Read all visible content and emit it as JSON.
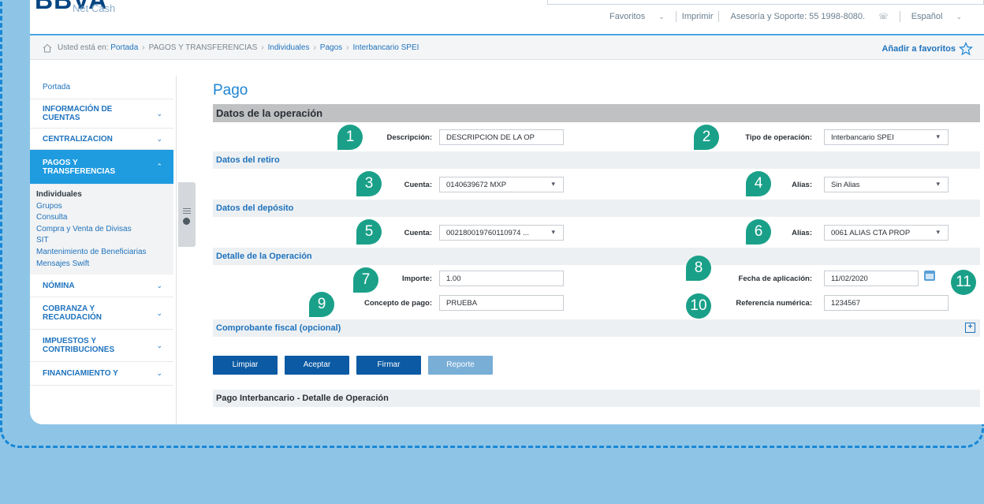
{
  "brand": {
    "logo": "BBVA",
    "sub": "Net Cash"
  },
  "topnav": {
    "favoritos": "Favoritos",
    "imprimir": "Imprimir",
    "soporte": "Asesoría y Soporte: 55 1998-8080.",
    "idioma": "Español"
  },
  "breadcrumb": {
    "prefix": "Usted está en:",
    "items": [
      "Portada",
      "PAGOS Y TRANSFERENCIAS",
      "Individuales",
      "Pagos",
      "Interbancario SPEI"
    ],
    "favorites_label": "Añadir a favoritos"
  },
  "sidebar": {
    "portada": "Portada",
    "info_cuentas": "INFORMACIÓN DE CUENTAS",
    "centralizacion": "CENTRALIZACION",
    "pagos": "PAGOS Y TRANSFERENCIAS",
    "sub_items": [
      "Individuales",
      "Grupos",
      "Consulta",
      "Compra y Venta de Divisas",
      "SIT",
      "Mantenimiento de Beneficiarias",
      "Mensajes Swift"
    ],
    "nomina": "NÓMINA",
    "cobranza": "COBRANZA Y RECAUDACIÓN",
    "impuestos": "IMPUESTOS Y CONTRIBUCIONES",
    "financiamiento": "FINANCIAMIENTO Y"
  },
  "page": {
    "title": "Pago",
    "sec_operacion": "Datos de la operación",
    "descripcion_label": "Descripción:",
    "descripcion_value": "DESCRIPCION DE LA OP",
    "tipo_label": "Tipo de operación:",
    "tipo_value": "Interbancario SPEI",
    "sec_retiro": "Datos del retiro",
    "cuenta_retiro_label": "Cuenta:",
    "cuenta_retiro_value": "0140639672 MXP",
    "alias_retiro_label": "Alias:",
    "alias_retiro_value": "Sin Alias",
    "sec_deposito": "Datos del depósito",
    "cuenta_dep_label": "Cuenta:",
    "cuenta_dep_value": "002180019760110974 ...",
    "alias_dep_label": "Alias:",
    "alias_dep_value": "0061 ALIAS CTA PROP",
    "sec_detalle": "Detalle de la Operación",
    "importe_label": "Importe:",
    "importe_value": "1.00",
    "fecha_label": "Fecha de aplicación:",
    "fecha_value": "11/02/2020",
    "concepto_label": "Concepto de pago:",
    "concepto_value": "PRUEBA",
    "referencia_label": "Referencia numérica:",
    "referencia_value": "1234567",
    "sec_comprobante": "Comprobante fiscal (opcional)",
    "plus": "+",
    "btn_limpiar": "Limpiar",
    "btn_aceptar": "Aceptar",
    "btn_firmar": "Firmar",
    "btn_reporte": "Reporte",
    "sec_detalle_op": "Pago Interbancario - Detalle de Operación"
  },
  "badges": [
    "1",
    "2",
    "3",
    "4",
    "5",
    "6",
    "7",
    "8",
    "9",
    "10",
    "11"
  ],
  "colors": {
    "accent": "#1e86d3",
    "brand": "#004481",
    "badge": "#1aa089",
    "button": "#0b5aa3",
    "background": "#8ec5e6"
  }
}
